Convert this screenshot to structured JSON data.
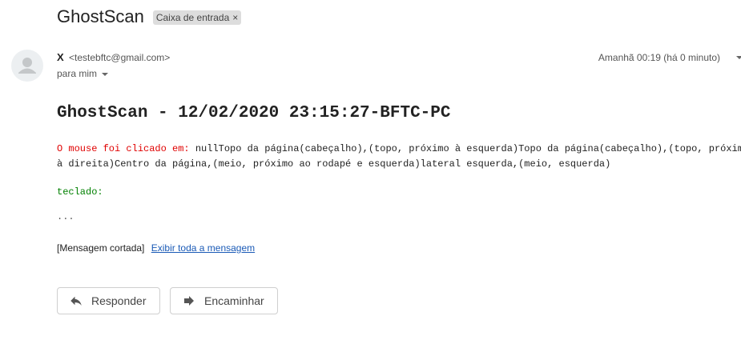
{
  "header": {
    "subject": "GhostScan",
    "label": "Caixa de entrada",
    "label_remove": "×"
  },
  "message": {
    "sender_name": "X",
    "sender_email": "<testebftc@gmail.com>",
    "recipient": "para mim",
    "timestamp": "Amanhã 00:19 (há 0 minuto)",
    "heading": "GhostScan - 12/02/2020 23:15:27-BFTC-PC",
    "click_label": "O mouse foi clicado em:",
    "click_text": " nullTopo da página(cabeçalho),(topo, próximo à esquerda)Topo da página(cabeçalho),(topo, próximo à direita)Centro da página,(meio, próximo ao rodapé e esquerda)lateral esquerda,(meio, esquerda)",
    "keys_label": "teclado:",
    "ellipsis": "...",
    "trimmed_notice": "[Mensagem cortada]",
    "show_full_link": "Exibir toda a mensagem"
  },
  "actions": {
    "reply": "Responder",
    "forward": "Encaminhar"
  },
  "icons": {
    "avatar": "default-person-icon",
    "reply": "reply-arrow-icon",
    "forward": "forward-arrow-icon"
  },
  "colors": {
    "click_label": "#e00000",
    "keys_label": "#008000",
    "link": "#1a5ab6",
    "label_chip": "#dddddd"
  }
}
